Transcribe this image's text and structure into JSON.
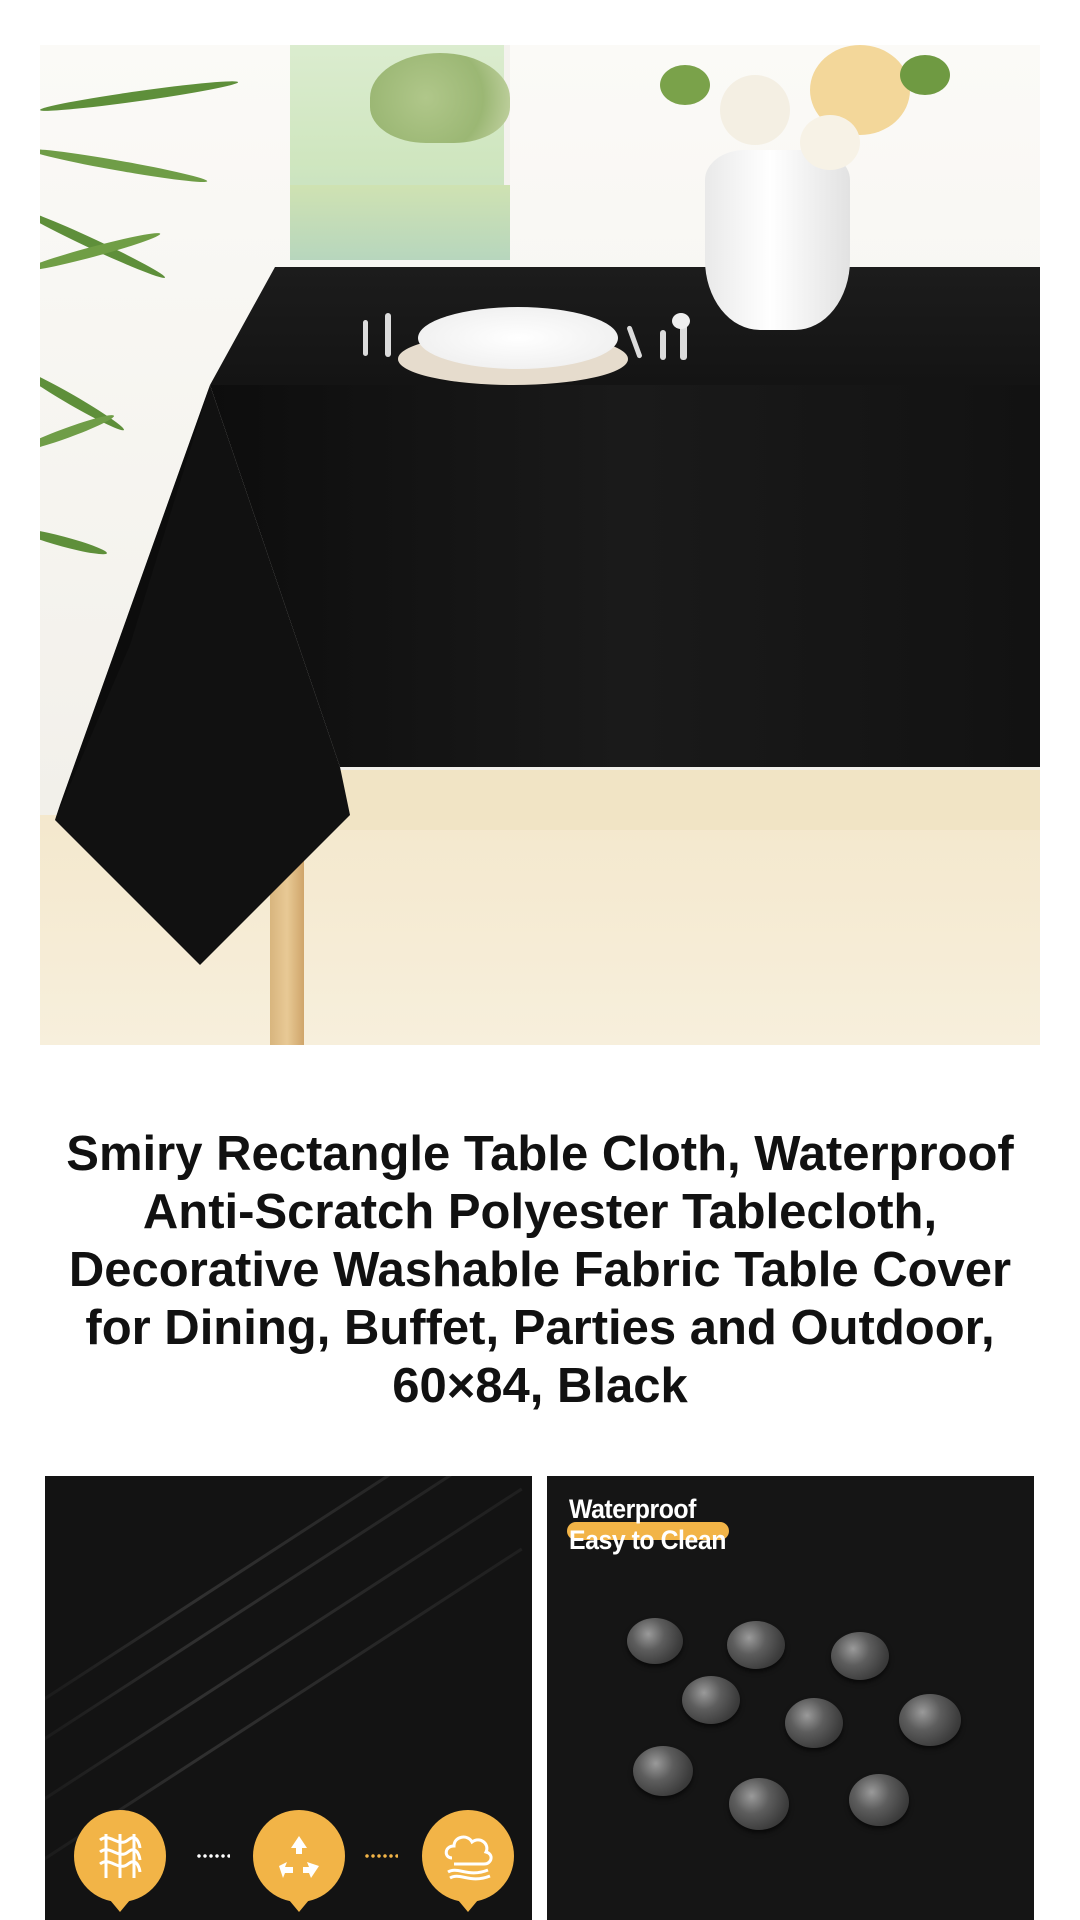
{
  "product": {
    "title": "Smiry Rectangle Table Cloth, Waterproof Anti-Scratch Polyester Tablecloth, Decorative Washable Fabric Table Cover for Dining, Buffet, Parties and Outdoor, 60×84, Black",
    "color": "Black"
  },
  "images": {
    "hero_alt": "black tablecloth on dining table",
    "tile_left": {
      "badges": [
        "fabric-weave-icon",
        "recycle-icon",
        "washable-cloud-icon"
      ]
    },
    "tile_right": {
      "headline_line1": "Waterproof",
      "headline_line2": "Easy to Clean"
    }
  },
  "colors": {
    "accent": "#f2b447",
    "cloth": "#161616",
    "text": "#111111"
  }
}
